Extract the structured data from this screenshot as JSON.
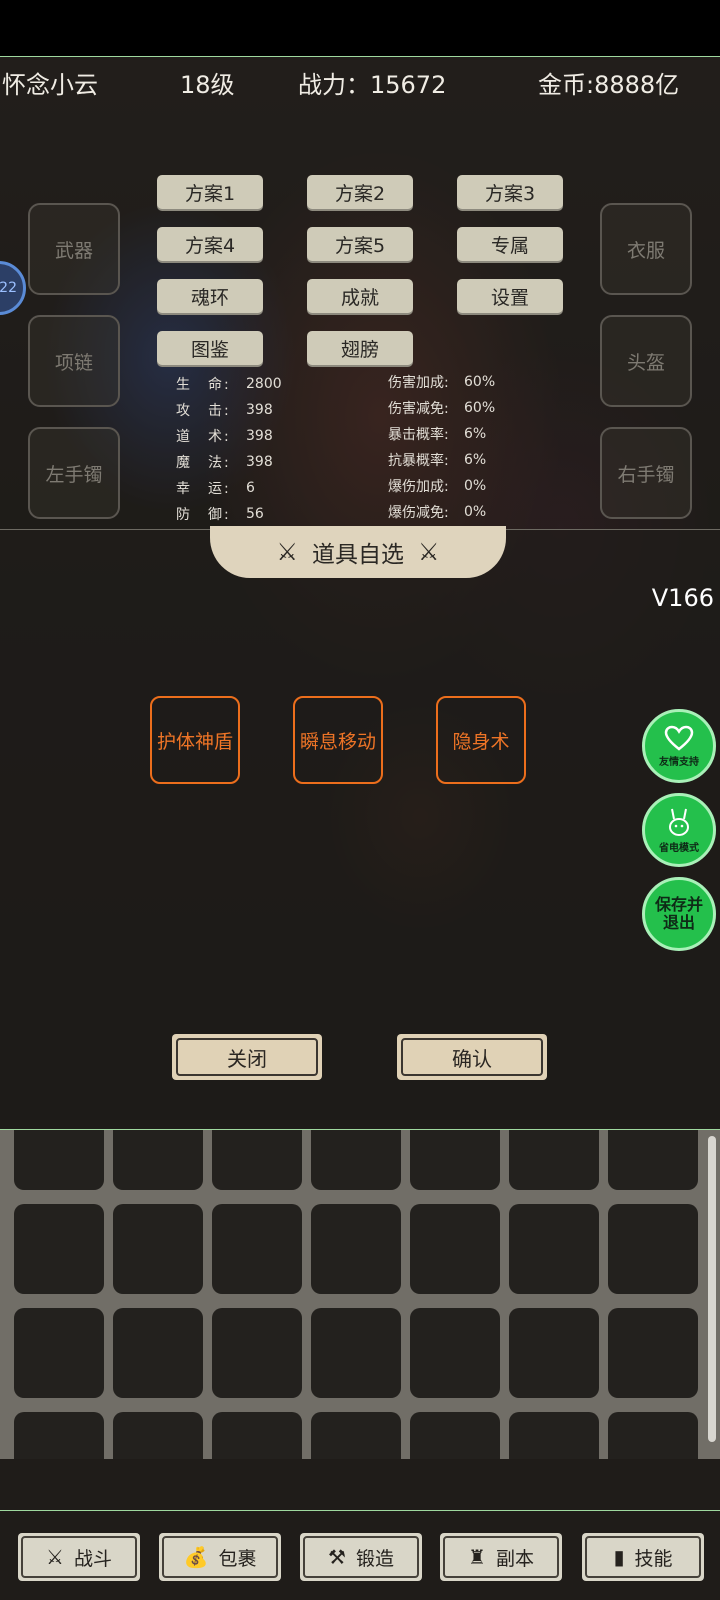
{
  "header": {
    "player_name": "怀念小云",
    "level": "18级",
    "power": "战力：15672",
    "gold": "金币:8888亿"
  },
  "equipment": {
    "weapon": "武器",
    "necklace": "项链",
    "left_bracelet": "左手镯",
    "clothes": "衣服",
    "helmet": "头盔",
    "right_bracelet": "右手镯"
  },
  "left_badge": "22",
  "plans": [
    "方案1",
    "方案2",
    "方案3",
    "方案4",
    "方案5",
    "专属",
    "魂环",
    "成就",
    "设置",
    "图鉴",
    "翅膀"
  ],
  "stats_left": [
    {
      "key": "生　命:",
      "value": "2800"
    },
    {
      "key": "攻　击:",
      "value": "398"
    },
    {
      "key": "道　术:",
      "value": "398"
    },
    {
      "key": "魔　法:",
      "value": "398"
    },
    {
      "key": "幸　运:",
      "value": "6"
    },
    {
      "key": "防　御:",
      "value": "56"
    }
  ],
  "stats_right": [
    {
      "key": "伤害加成:",
      "value": "60%"
    },
    {
      "key": "伤害减免:",
      "value": "60%"
    },
    {
      "key": "暴击概率:",
      "value": "6%"
    },
    {
      "key": "抗暴概率:",
      "value": "6%"
    },
    {
      "key": "爆伤加成:",
      "value": "0%"
    },
    {
      "key": "爆伤减免:",
      "value": "0%"
    }
  ],
  "dialog": {
    "title": "道具自选",
    "version": "V166",
    "options": [
      "护体神盾",
      "瞬息移动",
      "隐身术"
    ],
    "close_label": "关闭",
    "confirm_label": "确认"
  },
  "side_buttons": {
    "support": "友情支持",
    "power_save": "省电模式",
    "save_exit": "保存并退出"
  },
  "bottom_nav": [
    {
      "label": "战斗",
      "icon": "crossed-swords-icon"
    },
    {
      "label": "包裹",
      "icon": "bag-icon"
    },
    {
      "label": "锻造",
      "icon": "hammer-icon"
    },
    {
      "label": "副本",
      "icon": "tower-icon"
    },
    {
      "label": "技能",
      "icon": "book-icon"
    }
  ],
  "colors": {
    "accent_orange": "#ec6e1c",
    "fab_green": "#24c04c",
    "panel_beige": "#dfd4bd"
  }
}
